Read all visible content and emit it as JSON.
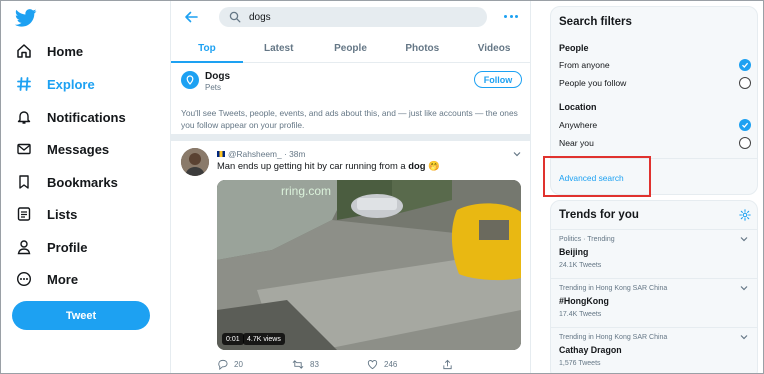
{
  "nav": {
    "items": [
      {
        "label": "Home",
        "icon": "home-icon"
      },
      {
        "label": "Explore",
        "icon": "hashtag-icon"
      },
      {
        "label": "Notifications",
        "icon": "bell-icon"
      },
      {
        "label": "Messages",
        "icon": "envelope-icon"
      },
      {
        "label": "Bookmarks",
        "icon": "bookmark-icon"
      },
      {
        "label": "Lists",
        "icon": "list-icon"
      },
      {
        "label": "Profile",
        "icon": "person-icon"
      },
      {
        "label": "More",
        "icon": "more-circle-icon"
      }
    ],
    "active": "Explore",
    "tweet_button": "Tweet"
  },
  "search": {
    "query": "dogs"
  },
  "tabs": [
    "Top",
    "Latest",
    "People",
    "Photos",
    "Videos"
  ],
  "active_tab": "Top",
  "topic": {
    "title": "Dogs",
    "subtitle": "Pets",
    "follow_label": "Follow",
    "description": "You'll see Tweets, people, events, and ads about this, and — just like accounts — the ones you follow appear on your profile."
  },
  "tweet": {
    "handle": "@Rahsheem_",
    "time": "· 38m",
    "text_before": "Man ends up getting hit by car running from a ",
    "text_bold": "dog",
    "emoji": "🤭",
    "watermark": "rring.com",
    "duration": "0:01",
    "views": "4.7K views",
    "replies": "20",
    "retweets": "83",
    "likes": "246"
  },
  "search_filters": {
    "title": "Search filters",
    "people_heading": "People",
    "people_options": [
      {
        "label": "From anyone",
        "selected": true
      },
      {
        "label": "People you follow",
        "selected": false
      }
    ],
    "location_heading": "Location",
    "location_options": [
      {
        "label": "Anywhere",
        "selected": true
      },
      {
        "label": "Near you",
        "selected": false
      }
    ],
    "advanced_link": "Advanced search"
  },
  "trends": {
    "title": "Trends for you",
    "items": [
      {
        "context": "Politics · Trending",
        "name": "Beijing",
        "count": "24.1K Tweets"
      },
      {
        "context": "Trending in Hong Kong SAR China",
        "name": "#HongKong",
        "count": "17.4K Tweets"
      },
      {
        "context": "Trending in Hong Kong SAR China",
        "name": "Cathay Dragon",
        "count": "1,576 Tweets"
      }
    ]
  },
  "colors": {
    "accent": "#1da1f2",
    "highlight_box": "#e0322e"
  }
}
